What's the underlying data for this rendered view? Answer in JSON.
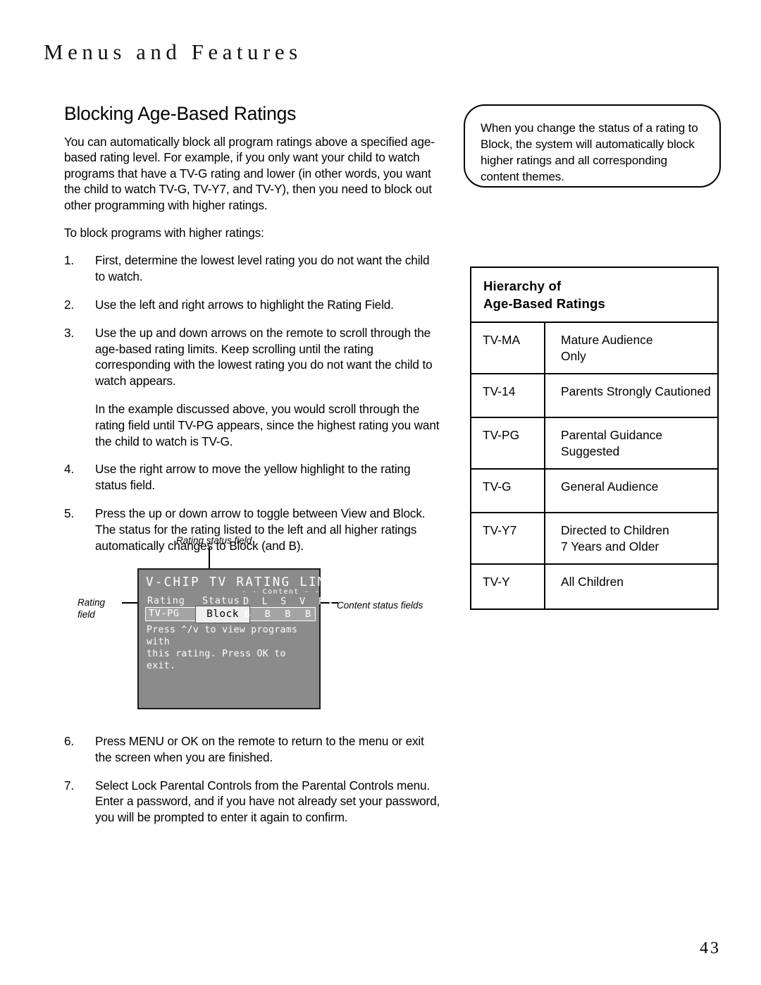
{
  "page": {
    "running_head": "Menus and Features",
    "folio": "43"
  },
  "section": {
    "title": "Blocking Age-Based Ratings",
    "intro": "You can automatically block all program ratings above a specified age-based rating level. For example, if you only want your child to watch programs that have a TV-G rating and lower (in other words, you want the child to watch TV-G, TV-Y7, and TV-Y), then you need to block out other programming with higher ratings.",
    "lead_in": "To block programs with higher ratings:",
    "steps": [
      {
        "num": "1.",
        "text": "First, determine the lowest level rating you do not want the child to watch."
      },
      {
        "num": "2.",
        "text": "Use the left and right arrows to highlight the Rating Field."
      },
      {
        "num": "3.",
        "text": "Use the up and down arrows on the remote to scroll through the age-based rating limits. Keep scrolling until the rating corresponding with the lowest rating you do not want the child to watch appears."
      },
      {
        "num": "4.",
        "text": "Use the right arrow to move the yellow highlight to the rating status field."
      },
      {
        "num": "5.",
        "text": "Press the up or down arrow to toggle between View and Block. The status for the rating listed to the left and all higher ratings automatically changes to Block (and B)."
      },
      {
        "num": "6.",
        "text": "Press MENU or OK on the remote to return to the menu or exit the screen when you are finished."
      },
      {
        "num": "7.",
        "text": "Select Lock Parental Controls from the Parental Controls menu. Enter a password, and if you have not already set your password, you will be prompted to enter it again to confirm."
      }
    ],
    "step3_note": "In the example discussed above, you would scroll through the rating field until TV-PG appears, since the highest rating you want the child to watch is TV-G."
  },
  "tip": {
    "text": "When you change the status of a rating to Block, the system will automatically block higher ratings and all corresponding content themes."
  },
  "hierarchy": {
    "heading_line1": "Hierarchy of",
    "heading_line2": "Age-Based Ratings",
    "rows": [
      {
        "code": "TV-MA",
        "desc": "Mature Audience\nOnly"
      },
      {
        "code": "TV-14",
        "desc": "Parents Strongly Cautioned"
      },
      {
        "code": "TV-PG",
        "desc": "Parental Guidance\nSuggested"
      },
      {
        "code": "TV-G",
        "desc": "General Audience"
      },
      {
        "code": "TV-Y7",
        "desc": "Directed to Children\n7 Years and Older"
      },
      {
        "code": "TV-Y",
        "desc": "All Children"
      }
    ]
  },
  "osd": {
    "title": "V-CHIP TV RATING LIMIT",
    "content_group_label": "- - Content - -",
    "col_rating": "Rating",
    "col_status": "Status",
    "col_content_letters": "D L S V FV",
    "rating_value": "TV-PG",
    "status_value": "Block",
    "content_values": "B B B B",
    "help_text": "Press ^/v to view programs with\nthis rating. Press OK to exit.",
    "screen_bg": "#8b8b8b",
    "strip_bg": "#a4a4a4",
    "highlight_bg": "#efefef"
  },
  "callouts": {
    "rating_status_field": "Rating status field",
    "rating_field": "Rating\nfield",
    "content_status_fields": "Content status fields"
  }
}
